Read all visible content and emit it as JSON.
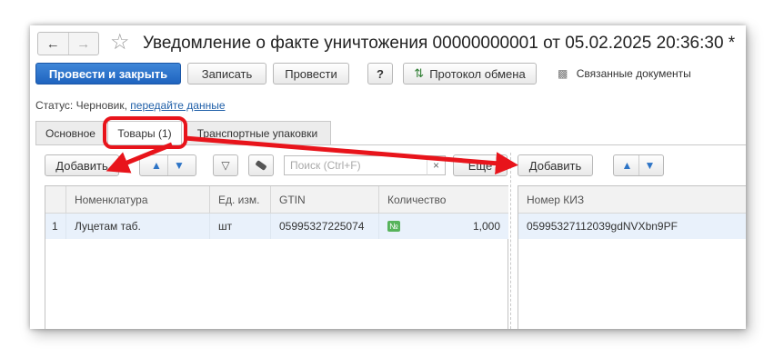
{
  "window": {
    "title": "Уведомление о факте уничтожения 00000000001 от 05.02.2025 20:36:30 *"
  },
  "nav": {
    "back_icon": "arrow-left-icon",
    "forward_icon": "arrow-right-icon",
    "star_icon": "star-icon"
  },
  "toolbar": {
    "post_close": "Провести и закрыть",
    "write": "Записать",
    "post": "Провести",
    "help": "?",
    "exchange_protocol": "Протокол обмена",
    "related_docs": "Связанные документы"
  },
  "status": {
    "label": "Статус:",
    "value": "Черновик,",
    "link": "передайте данные"
  },
  "tabs": [
    {
      "label": "Основное"
    },
    {
      "label": "Товары (1)"
    },
    {
      "label": "Транспортные упаковки"
    }
  ],
  "left_panel": {
    "add_button": "Добавить",
    "search_placeholder": "Поиск (Ctrl+F)",
    "search_clear": "×",
    "more_button": "Еще",
    "columns": [
      "Номенклатура",
      "Ед. изм.",
      "GTIN",
      "Количество"
    ],
    "rows": [
      {
        "n": "1",
        "name": "Луцетам таб.",
        "unit": "шт",
        "gtin": "05995327225074",
        "badge": "№",
        "qty": "1,000"
      }
    ]
  },
  "right_panel": {
    "add_button": "Добавить",
    "columns": [
      "Номер КИЗ"
    ],
    "rows": [
      {
        "kiz": "05995327112039gdNVXbn9PF"
      }
    ]
  },
  "annotation_color": "#e8141b"
}
